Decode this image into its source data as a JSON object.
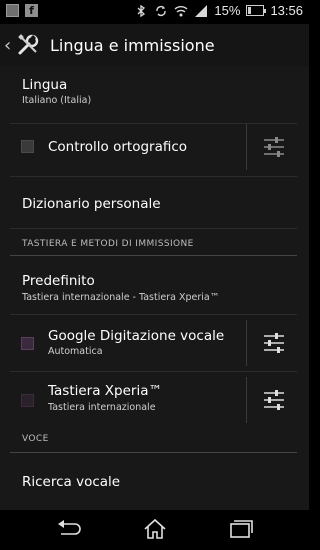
{
  "status_bar": {
    "left_icons": [
      "image-notification-icon",
      "facebook-icon"
    ],
    "facebook_glyph": "f",
    "right_icons": [
      "bluetooth-icon",
      "sync-icon",
      "wifi-icon",
      "signal-icon"
    ],
    "battery_percent": "15%",
    "battery_level": 0.15,
    "time": "13:56"
  },
  "action_bar": {
    "back_glyph": "‹",
    "title": "Lingua e immissione"
  },
  "settings": {
    "lingua": {
      "title": "Lingua",
      "summary": "Italiano (Italia)"
    },
    "spell": {
      "title": "Controllo ortografico",
      "checked": false
    },
    "dictionary": {
      "title": "Dizionario personale"
    },
    "section_keyboards": "TASTIERA E METODI DI IMMISSIONE",
    "default_kb": {
      "title": "Predefinito",
      "summary": "Tastiera internazionale - Tastiera Xperia™"
    },
    "google_voice": {
      "title": "Google Digitazione vocale",
      "summary": "Automatica",
      "checked": true
    },
    "xperia_kb": {
      "title": "Tastiera Xperia™",
      "summary": "Tastiera internazionale",
      "checked": true
    },
    "section_voice": "VOCE",
    "voice_search": {
      "title": "Ricerca vocale"
    }
  },
  "nav_bar": {
    "buttons": [
      "back",
      "home",
      "recent-apps"
    ]
  },
  "colors": {
    "background": "#181818",
    "action_bar": "#151515",
    "checked_box": "#3b2a3d"
  }
}
